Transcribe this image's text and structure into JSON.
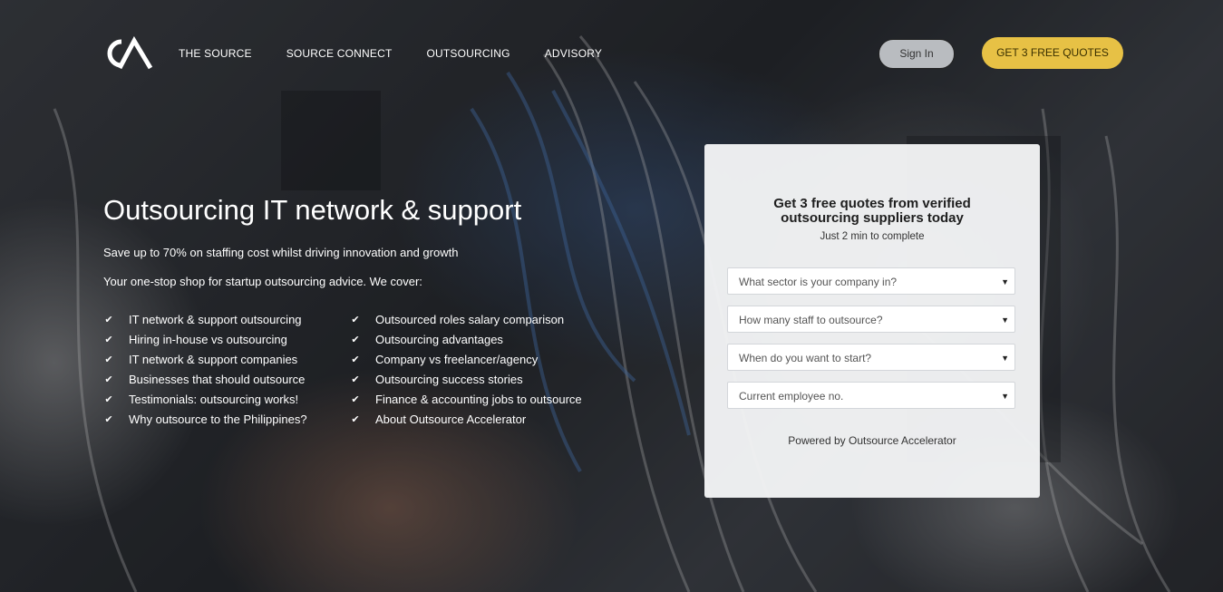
{
  "brand": {
    "logo_text": "CA"
  },
  "nav": {
    "items": [
      {
        "label": "THE SOURCE"
      },
      {
        "label": "SOURCE CONNECT"
      },
      {
        "label": "OUTSOURCING"
      },
      {
        "label": "ADVISORY"
      }
    ],
    "signin_label": "Sign In",
    "cta_label": "GET 3 FREE QUOTES"
  },
  "hero": {
    "title": "Outsourcing IT network & support",
    "subtitle": "Save up to 70% on staffing cost whilst driving innovation and growth",
    "intro": "Your one-stop shop for startup outsourcing advice.  We cover:",
    "links_col1": [
      "IT network & support outsourcing",
      "Hiring in-house vs outsourcing",
      "IT network & support companies",
      "Businesses that should outsource",
      "Testimonials: outsourcing works!",
      "Why outsource to the Philippines?"
    ],
    "links_col2": [
      "Outsourced roles salary comparison",
      "Outsourcing advantages",
      "Company vs freelancer/agency",
      "Outsourcing success stories",
      "Finance & accounting jobs to outsource",
      "About Outsource Accelerator"
    ]
  },
  "form": {
    "heading_line1": "Get 3 free quotes from verified",
    "heading_line2": "outsourcing suppliers today",
    "subheading": "Just 2 min to complete",
    "selects": [
      {
        "placeholder": "What sector is your company in?"
      },
      {
        "placeholder": "How many staff to outsource?"
      },
      {
        "placeholder": "When do you want to start?"
      },
      {
        "placeholder": "Current employee no."
      }
    ],
    "powered_by": "Powered by Outsource Accelerator"
  },
  "colors": {
    "cta_yellow": "#e7c145",
    "signin_gray": "#b9bcc0",
    "card_bg": "#f4f5f6"
  },
  "icons": {
    "check": "check-icon",
    "select_arrow": "caret-down-icon"
  }
}
